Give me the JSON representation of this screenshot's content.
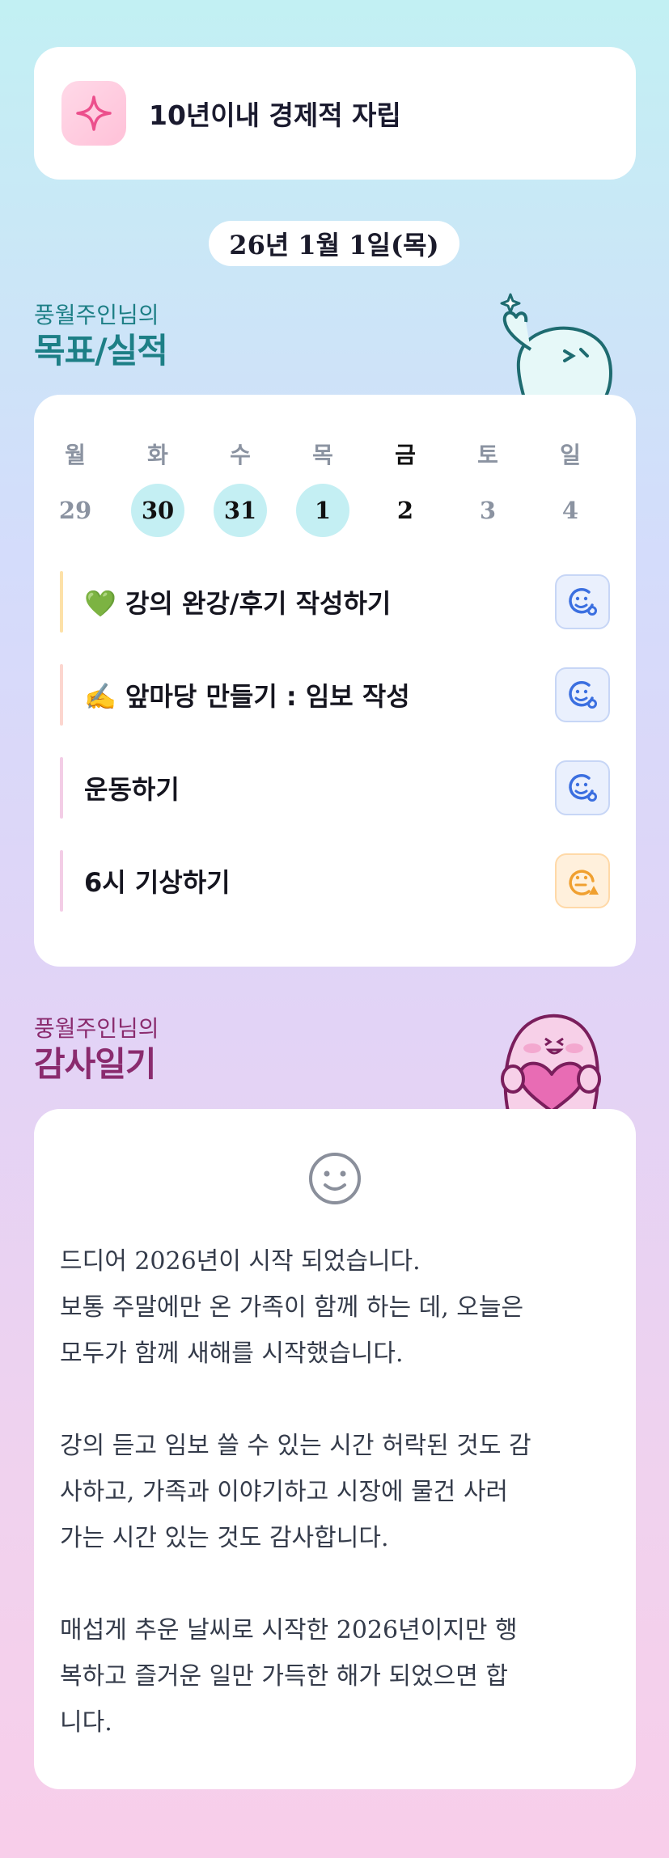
{
  "goal": {
    "title": "10년이내 경제적 자립"
  },
  "date": "26년 1월 1일(목)",
  "goals_section": {
    "subtitle": "풍월주인님의",
    "title": "목표/실적"
  },
  "week": {
    "days": [
      "월",
      "화",
      "수",
      "목",
      "금",
      "토",
      "일"
    ],
    "dates": [
      "29",
      "30",
      "31",
      "1",
      "2",
      "3",
      "4"
    ]
  },
  "tasks": [
    {
      "label": "💚 강의 완강/후기 작성하기",
      "status": "blue-smile"
    },
    {
      "label": "✍️ 앞마당 만들기 : 임보 작성",
      "status": "blue-smile"
    },
    {
      "label": "운동하기",
      "status": "blue-smile"
    },
    {
      "label": "6시 기상하기",
      "status": "orange-warning"
    }
  ],
  "gratitude_section": {
    "subtitle": "풍월주인님의",
    "title": "감사일기"
  },
  "journal": {
    "p1": "드디어 2026년이 시작 되었습니다.\n보통 주말에만 온 가족이 함께 하는 데, 오늘은\n모두가 함께 새해를 시작했습니다.",
    "p2": "강의 듣고 임보 쓸 수 있는 시간 허락된 것도 감\n사하고, 가족과 이야기하고 시장에 물건 사러\n가는 시간 있는 것도 감사합니다.",
    "p3": "매섭게 추운 날씨로 시작한 2026년이지만 행\n복하고 즐거운 일만 가득한 해가 되었으면 합\n니다."
  },
  "colors": {
    "teal": "#1d7f86",
    "purple": "#8a2b6e",
    "done": "#c4eff3",
    "blue": "#3b6fe0",
    "orange": "#f0a030"
  }
}
